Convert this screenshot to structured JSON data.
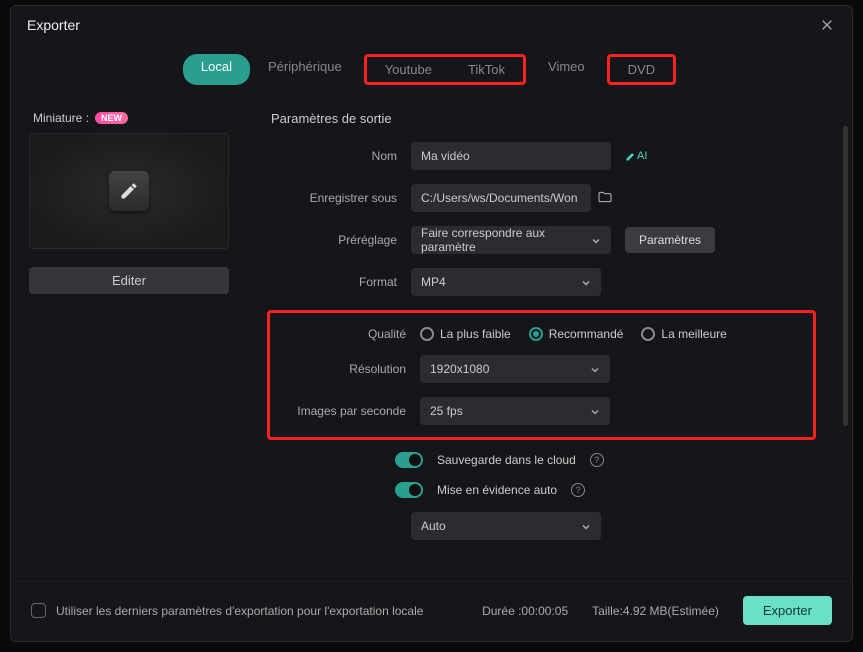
{
  "title": "Exporter",
  "tabs": {
    "local": "Local",
    "peripherique": "Périphérique",
    "youtube": "Youtube",
    "tiktok": "TikTok",
    "vimeo": "Vimeo",
    "dvd": "DVD"
  },
  "miniature": {
    "label": "Miniature :",
    "new_badge": "NEW",
    "edit": "Editer"
  },
  "output": {
    "section_title": "Paramètres de sortie",
    "name_label": "Nom",
    "name_value": "Ma vidéo",
    "ai_label": "AI",
    "save_as_label": "Enregistrer sous",
    "save_as_value": "C:/Users/ws/Documents/Won",
    "preset_label": "Préréglage",
    "preset_value": "Faire correspondre aux paramètre",
    "params_btn": "Paramètres",
    "format_label": "Format",
    "format_value": "MP4"
  },
  "quality": {
    "label": "Qualité",
    "lowest": "La plus faible",
    "recommended": "Recommandé",
    "best": "La meilleure",
    "resolution_label": "Résolution",
    "resolution_value": "1920x1080",
    "fps_label": "Images par seconde",
    "fps_value": "25 fps"
  },
  "toggles": {
    "cloud": "Sauvegarde dans le cloud",
    "highlight": "Mise en évidence auto",
    "auto_value": "Auto"
  },
  "footer": {
    "use_last": "Utiliser les derniers paramètres d'exportation pour l'exportation locale",
    "duration_label": "Durée :",
    "duration_value": "00:00:05",
    "size_label": "Taille:",
    "size_value": "4.92 MB(Estimée)",
    "export_btn": "Exporter"
  }
}
